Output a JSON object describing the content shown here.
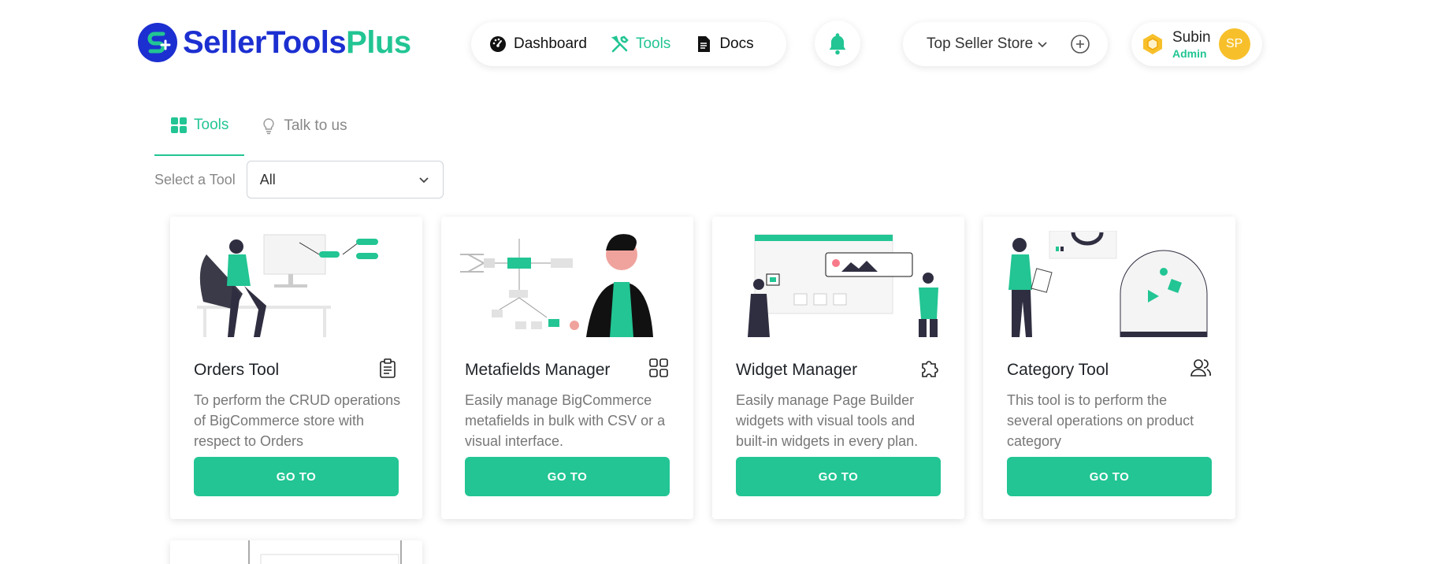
{
  "brand": {
    "part1": "SellerTools",
    "part2": "Plus",
    "accent": "#22c593",
    "primary": "#1c2fd1"
  },
  "nav": {
    "items": [
      {
        "label": "Dashboard",
        "icon": "gauge-icon"
      },
      {
        "label": "Tools",
        "icon": "tools-icon"
      },
      {
        "label": "Docs",
        "icon": "document-icon"
      }
    ]
  },
  "header": {
    "store": "Top Seller Store",
    "user_name": "Subin",
    "user_role": "Admin",
    "avatar_initials": "SP"
  },
  "tabs": [
    {
      "label": "Tools",
      "icon": "grid-icon"
    },
    {
      "label": "Talk to us",
      "icon": "lightbulb-icon"
    }
  ],
  "filter": {
    "label": "Select a Tool",
    "value": "All"
  },
  "cards": [
    {
      "title": "Orders Tool",
      "icon": "clipboard-icon",
      "description": "To perform the CRUD operations of BigCommerce store with respect to Orders",
      "button": "GO TO"
    },
    {
      "title": "Metafields Manager",
      "icon": "grid-icon",
      "description": "Easily manage BigCommerce metafields in bulk with CSV or a visual interface.",
      "button": "GO TO"
    },
    {
      "title": "Widget Manager",
      "icon": "puzzle-icon",
      "description": "Easily manage Page Builder widgets with visual tools and built-in widgets in every plan.",
      "button": "GO TO"
    },
    {
      "title": "Category Tool",
      "icon": "users-icon",
      "description": "This tool is to perform the several operations on product category",
      "button": "GO TO"
    }
  ]
}
